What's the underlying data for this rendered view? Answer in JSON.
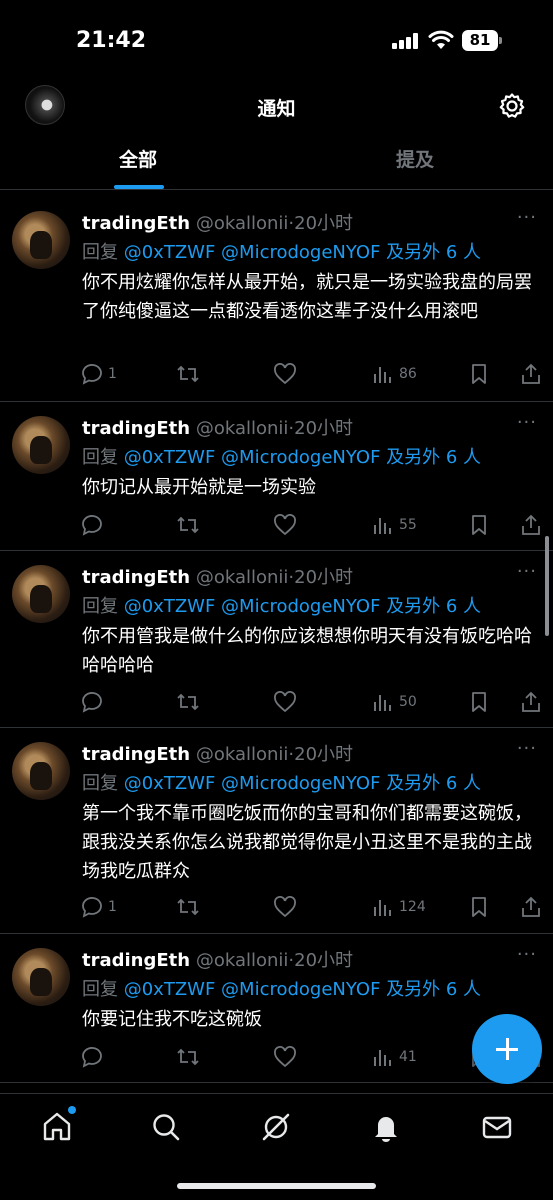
{
  "status_bar": {
    "time": "21:42",
    "battery": "81"
  },
  "header": {
    "title": "通知"
  },
  "tabs": [
    {
      "label": "全部"
    },
    {
      "label": "提及"
    }
  ],
  "tweets": [
    {
      "name": "tradingEth",
      "handle": "@okallonii",
      "time": "20小时",
      "reply_label": "回复",
      "mentions": "@0xTZWF @MicrodogeNYOF",
      "others": "及另外 6 人",
      "text": "你不用炫耀你怎样从最开始，就只是一场实验我盘的局罢了你纯傻逼这一点都没看透你这辈子没什么用滚吧",
      "replies": "1",
      "reposts": "",
      "likes": "",
      "views": "86"
    },
    {
      "name": "tradingEth",
      "handle": "@okallonii",
      "time": "20小时",
      "reply_label": "回复",
      "mentions": "@0xTZWF @MicrodogeNYOF",
      "others": "及另外 6 人",
      "text": "你切记从最开始就是一场实验",
      "replies": "",
      "reposts": "",
      "likes": "",
      "views": "55"
    },
    {
      "name": "tradingEth",
      "handle": "@okallonii",
      "time": "20小时",
      "reply_label": "回复",
      "mentions": "@0xTZWF @MicrodogeNYOF",
      "others": "及另外 6 人",
      "text": "你不用管我是做什么的你应该想想你明天有没有饭吃哈哈哈哈哈哈",
      "replies": "",
      "reposts": "",
      "likes": "",
      "views": "50"
    },
    {
      "name": "tradingEth",
      "handle": "@okallonii",
      "time": "20小时",
      "reply_label": "回复",
      "mentions": "@0xTZWF @MicrodogeNYOF",
      "others": "及另外 6 人",
      "text": "第一个我不靠币圈吃饭而你的宝哥和你们都需要这碗饭，跟我没关系你怎么说我都觉得你是小丑这里不是我的主战场我吃瓜群众",
      "replies": "1",
      "reposts": "",
      "likes": "",
      "views": "124"
    },
    {
      "name": "tradingEth",
      "handle": "@okallonii",
      "time": "20小时",
      "reply_label": "回复",
      "mentions": "@0xTZWF @MicrodogeNYOF",
      "others": "及另外 6 人",
      "text": "你要记住我不吃这碗饭",
      "replies": "",
      "reposts": "",
      "likes": "",
      "views": "41"
    }
  ],
  "nav": [
    "home-icon",
    "search-icon",
    "grok-icon",
    "notifications-icon",
    "messages-icon"
  ],
  "colors": {
    "accent": "#1d9bf0",
    "background": "#000000",
    "muted": "#71767b"
  }
}
